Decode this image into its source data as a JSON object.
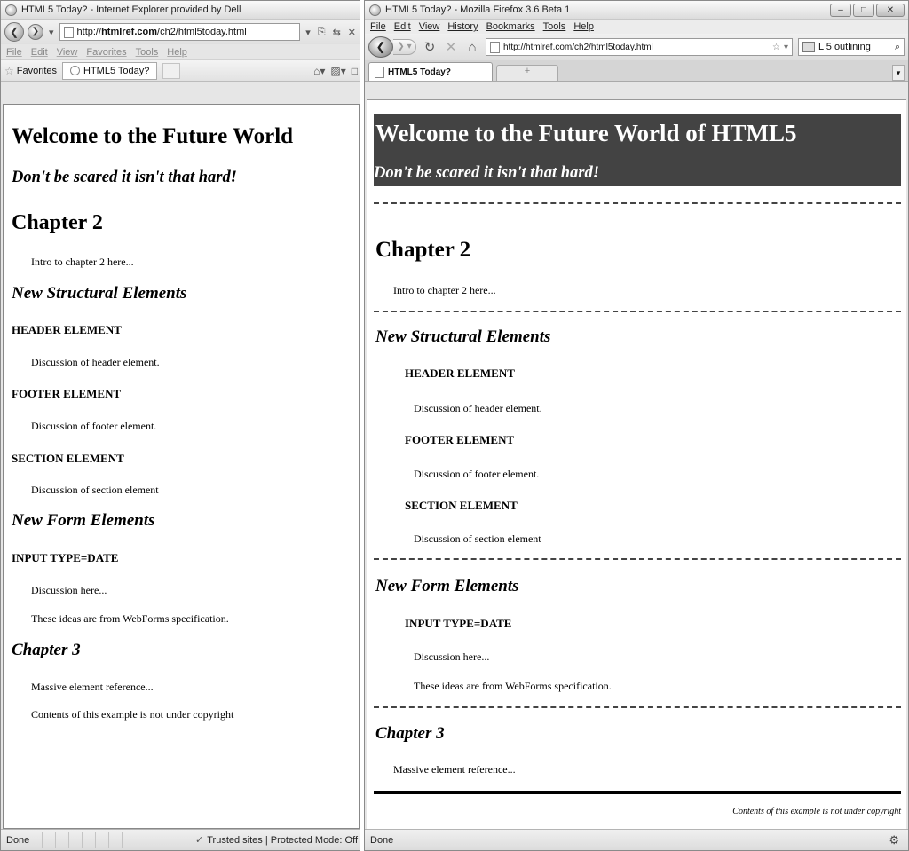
{
  "ie": {
    "title": "HTML5 Today? - Internet Explorer provided by Dell",
    "url_prefix": "http://",
    "url_host": "htmlref.com",
    "url_path": "/ch2/html5today.html",
    "menu": [
      "File",
      "Edit",
      "View",
      "Favorites",
      "Tools",
      "Help"
    ],
    "favorites_label": "Favorites",
    "tab_label": "HTML5 Today?",
    "status_text": "Done",
    "zone_text": "Trusted sites | Protected Mode: Off",
    "page": {
      "heading": "Welcome to the Future World",
      "subheading": "Don't be scared it isn't that hard!",
      "chapter2": "Chapter 2",
      "intro": "Intro to chapter 2 here...",
      "structural": "New Structural Elements",
      "header_el": "HEADER ELEMENT",
      "header_disc": "Discussion of header element.",
      "footer_el": "FOOTER ELEMENT",
      "footer_disc": "Discussion of footer element.",
      "section_el": "SECTION ELEMENT",
      "section_disc": "Discussion of section element",
      "form": "New Form Elements",
      "input_date": "INPUT TYPE=DATE",
      "disc_here": "Discussion here...",
      "webforms": "These ideas are from WebForms specification.",
      "chapter3": "Chapter 3",
      "massive": "Massive element reference...",
      "copyright": "Contents of this example is not under copyright"
    }
  },
  "ff": {
    "title": "HTML5 Today? - Mozilla Firefox 3.6 Beta 1",
    "menu": [
      "File",
      "Edit",
      "View",
      "History",
      "Bookmarks",
      "Tools",
      "Help"
    ],
    "url": "http://htmlref.com/ch2/html5today.html",
    "search_text": "L 5 outlining",
    "tab_label": "HTML5 Today?",
    "new_tab_label": "+",
    "status_text": "Done",
    "page": {
      "heading": "Welcome to the Future World of HTML5",
      "subheading": "Don't be scared it isn't that hard!",
      "chapter2": "Chapter 2",
      "intro": "Intro to chapter 2 here...",
      "structural": "New Structural Elements",
      "header_el": "HEADER ELEMENT",
      "header_disc": "Discussion of header element.",
      "footer_el": "FOOTER ELEMENT",
      "footer_disc": "Discussion of footer element.",
      "section_el": "SECTION ELEMENT",
      "section_disc": "Discussion of section element",
      "form": "New Form Elements",
      "input_date": "INPUT TYPE=DATE",
      "disc_here": "Discussion here...",
      "webforms": "These ideas are from WebForms specification.",
      "chapter3": "Chapter 3",
      "massive": "Massive element reference...",
      "copyright": "Contents of this example is not under copyright"
    }
  }
}
